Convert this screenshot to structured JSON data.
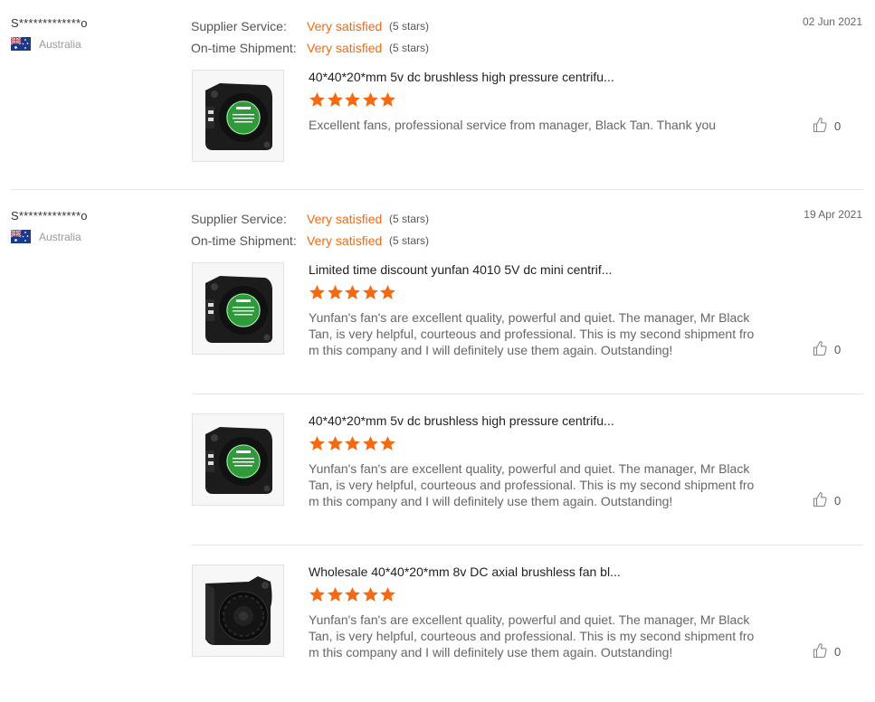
{
  "labels": {
    "supplier_service": "Supplier Service:",
    "ontime_shipment": "On-time Shipment:"
  },
  "colors": {
    "accent": "#f36a12",
    "star": "#f36a12"
  },
  "reviews": [
    {
      "buyer": "S*************o",
      "country": "Australia",
      "date": "02 Jun 2021",
      "supplier_service": {
        "value": "Very satisfied",
        "stars_text": "(5 stars)"
      },
      "ontime_shipment": {
        "value": "Very satisfied",
        "stars_text": "(5 stars)"
      },
      "products": [
        {
          "image_icon": "blower-fan-product-image",
          "title": "40*40*20*mm 5v dc brushless high pressure centrifu...",
          "rating": 5,
          "comment": "Excellent fans, professional service from manager, Black Tan. Thank you",
          "likes": "0"
        }
      ]
    },
    {
      "buyer": "S*************o",
      "country": "Australia",
      "date": "19 Apr 2021",
      "supplier_service": {
        "value": "Very satisfied",
        "stars_text": "(5 stars)"
      },
      "ontime_shipment": {
        "value": "Very satisfied",
        "stars_text": "(5 stars)"
      },
      "products": [
        {
          "image_icon": "blower-fan-product-image",
          "title": "Limited time discount yunfan 4010 5V dc mini centrif...",
          "rating": 5,
          "comment": "Yunfan's fan's are excellent quality, powerful and quiet. The manager, Mr Black Tan, is very helpful, courteous and professional. This is my second shipment from this company and I will definitely use them again. Outstanding!",
          "likes": "0"
        },
        {
          "image_icon": "blower-fan-product-image",
          "title": "40*40*20*mm 5v dc brushless high pressure centrifu...",
          "rating": 5,
          "comment": "Yunfan's fan's are excellent quality, powerful and quiet. The manager, Mr Black Tan, is very helpful, courteous and professional. This is my second shipment from this company and I will definitely use them again. Outstanding!",
          "likes": "0"
        },
        {
          "image_icon": "axial-blower-fan-product-image",
          "title": "Wholesale 40*40*20*mm 8v DC axial brushless fan bl...",
          "rating": 5,
          "comment": "Yunfan's fan's are excellent quality, powerful and quiet. The manager, Mr Black Tan, is very helpful, courteous and professional. This is my second shipment from this company and I will definitely use them again. Outstanding!",
          "likes": "0"
        }
      ]
    }
  ]
}
